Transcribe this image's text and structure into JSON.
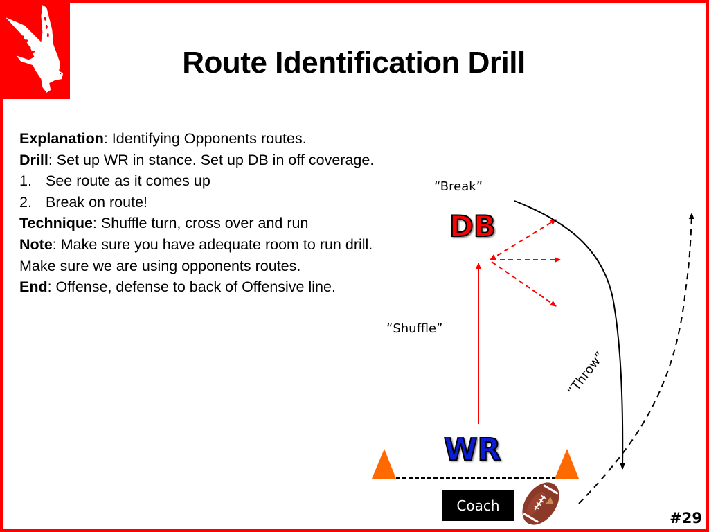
{
  "slide": {
    "title": "Route Identification Drill",
    "slide_number": "#29",
    "accent_color": "#ff0000",
    "logo": {
      "icon": "hawk-mascot-icon",
      "background": "#ff0000"
    }
  },
  "content": {
    "explanation": {
      "label": "Explanation",
      "text": ": Identifying Opponents routes."
    },
    "drill": {
      "label": "Drill",
      "text": ": Set up WR in stance.  Set up DB in off coverage."
    },
    "steps": [
      {
        "num": "1.",
        "text": "See route as it comes up"
      },
      {
        "num": "2.",
        "text": "Break on route!"
      }
    ],
    "technique": {
      "label": "Technique",
      "text": ": Shuffle turn, cross over and run"
    },
    "note": {
      "label": "Note",
      "text": ": Make sure you have adequate room to run drill. Make sure we are using opponents routes."
    },
    "end": {
      "label": "End",
      "text": ": Offense, defense to back of Offensive line."
    }
  },
  "diagram": {
    "labels": {
      "break": "“Break”",
      "shuffle": "“Shuffle”",
      "throw": "“Throw”",
      "db": "DB",
      "wr": "WR",
      "coach": "Coach"
    },
    "colors": {
      "db": "#ff0000",
      "wr": "#0000cc",
      "cone": "#ff6600",
      "route_red": "#ff0000",
      "route_black": "#000000",
      "coach_box": "#000000"
    },
    "icons": [
      "cone-icon",
      "football-icon"
    ]
  }
}
